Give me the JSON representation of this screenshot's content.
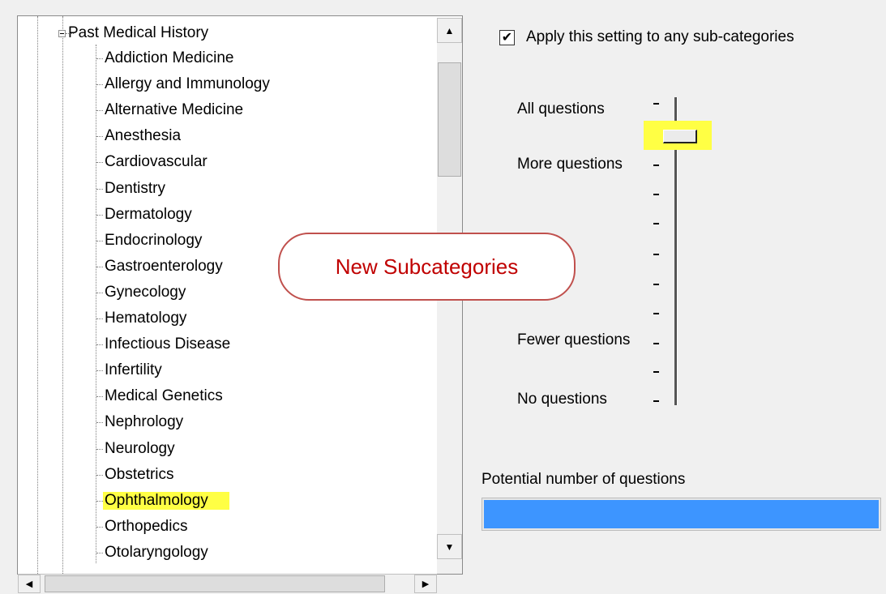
{
  "tree": {
    "root": "Past Medical History",
    "items": [
      {
        "label": "Addiction Medicine",
        "highlighted": false
      },
      {
        "label": "Allergy and Immunology",
        "highlighted": false
      },
      {
        "label": "Alternative Medicine",
        "highlighted": false
      },
      {
        "label": "Anesthesia",
        "highlighted": false
      },
      {
        "label": "Cardiovascular",
        "highlighted": false
      },
      {
        "label": "Dentistry",
        "highlighted": false
      },
      {
        "label": "Dermatology",
        "highlighted": false
      },
      {
        "label": "Endocrinology",
        "highlighted": false
      },
      {
        "label": "Gastroenterology",
        "highlighted": false
      },
      {
        "label": "Gynecology",
        "highlighted": false
      },
      {
        "label": "Hematology",
        "highlighted": false
      },
      {
        "label": "Infectious Disease",
        "highlighted": false
      },
      {
        "label": "Infertility",
        "highlighted": false
      },
      {
        "label": "Medical Genetics",
        "highlighted": false
      },
      {
        "label": "Nephrology",
        "highlighted": false
      },
      {
        "label": "Neurology",
        "highlighted": false
      },
      {
        "label": "Obstetrics",
        "highlighted": false
      },
      {
        "label": "Ophthalmology",
        "highlighted": true
      },
      {
        "label": "Orthopedics",
        "highlighted": false
      },
      {
        "label": "Otolaryngology",
        "highlighted": false
      }
    ]
  },
  "callout": {
    "text": "New Subcategories"
  },
  "settings": {
    "apply_checkbox": {
      "label": "Apply this setting to any sub-categories",
      "checked": true
    },
    "slider": {
      "labels": [
        "All questions",
        "More questions",
        "Fewer questions",
        "No questions"
      ],
      "selected_level": "one step below All questions"
    },
    "potential": {
      "label": "Potential number of questions",
      "fill_fraction": 1.0
    }
  },
  "colors": {
    "highlight": "#ffff44",
    "callout_border": "#c0504d",
    "callout_text": "#c00000",
    "progress_fill": "#3d95ff"
  },
  "icons": [
    "collapse-box-icon",
    "scroll-up-arrow-icon",
    "scroll-down-arrow-icon",
    "scroll-left-arrow-icon",
    "scroll-right-arrow-icon",
    "checkmark-icon"
  ]
}
